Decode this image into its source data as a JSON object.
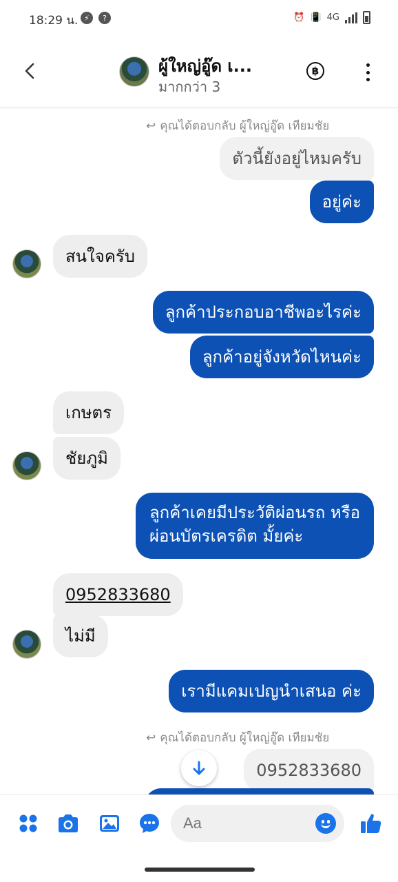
{
  "status_bar": {
    "time": "18:29 น.",
    "network": "4G",
    "colors": {
      "icons": "#444444"
    }
  },
  "header": {
    "name": "ผู้ใหญ่อู๊ด เ...",
    "subtitle": "มากกว่า 3",
    "baht_symbol": "฿",
    "icons": [
      "back-arrow-icon",
      "baht-icon",
      "more-vertical-icon"
    ]
  },
  "chat": {
    "reply_note_1": "คุณได้ตอบกลับ ผู้ใหญ่อู๊ด เทียมชัย",
    "messages": [
      {
        "side": "quoted",
        "text": "ตัวนี้ยังอยู่ไหมครับ"
      },
      {
        "side": "out",
        "text": "อยู่ค่ะ"
      },
      {
        "side": "in",
        "text": "สนใจครับ"
      },
      {
        "side": "out",
        "text": "ลูกค้าประกอบอาชีพอะไรค่ะ"
      },
      {
        "side": "out",
        "text": "ลูกค้าอยู่จังหวัดไหนค่ะ"
      },
      {
        "side": "in",
        "text": "เกษตร"
      },
      {
        "side": "in",
        "text": "ชัยภูมิ"
      },
      {
        "side": "out",
        "line1": "ลูกค้าเคยมีประวัติผ่อนรถ หรือ",
        "line2": "ผ่อนบัตรเครดิต มั้ยค่ะ"
      },
      {
        "side": "in",
        "text": "0952833680"
      },
      {
        "side": "in",
        "text": "ไม่มี"
      },
      {
        "side": "out",
        "text": "เรามีแคมเปญนำเสนอ ค่ะ"
      },
      {
        "side": "quoted",
        "text": "0952833680"
      }
    ],
    "reply_note_2": "คุณได้ตอบกลับ ผู้ใหญ่อู๊ด เทียมชัย",
    "colors": {
      "outgoing": "#0d51b5",
      "incoming": "#eeeeee"
    }
  },
  "composer": {
    "placeholder": "Aa",
    "icons": [
      "apps-icon",
      "camera-icon",
      "gallery-icon",
      "chat-bubble-icon",
      "emoji-icon",
      "thumbs-up-icon"
    ],
    "accent": "#1a73e8"
  }
}
